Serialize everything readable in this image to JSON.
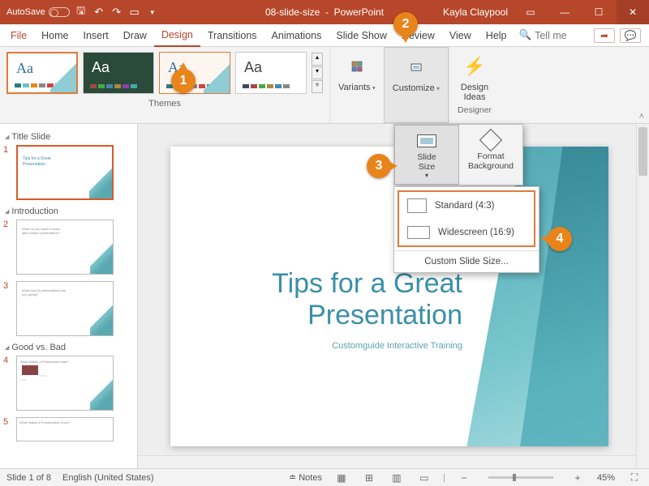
{
  "titlebar": {
    "autosave_label": "AutoSave",
    "doc_name": "08-slide-size",
    "app_name": "PowerPoint",
    "user": "Kayla Claypool"
  },
  "tabs": {
    "file": "File",
    "home": "Home",
    "insert": "Insert",
    "draw": "Draw",
    "design": "Design",
    "transitions": "Transitions",
    "animations": "Animations",
    "slideshow": "Slide Show",
    "review": "Review",
    "view": "View",
    "help": "Help",
    "tellme": "Tell me"
  },
  "ribbon": {
    "themes_label": "Themes",
    "variants_label": "Variants",
    "customize_label": "Customize",
    "designideas_label": "Design\nIdeas",
    "designer_label": "Designer"
  },
  "customize_panel": {
    "slide_size": "Slide\nSize",
    "format_bg": "Format\nBackground"
  },
  "slidesize_menu": {
    "standard": "Standard (4:3)",
    "widescreen": "Widescreen (16:9)",
    "custom": "Custom Slide Size..."
  },
  "sections": {
    "s1": "Title Slide",
    "s2": "Introduction",
    "s3": "Good vs. Bad"
  },
  "slide_nums": {
    "n1": "1",
    "n2": "2",
    "n3": "3",
    "n4": "4",
    "n5": "5"
  },
  "slide": {
    "title": "Tips for a Great Presentation",
    "subtitle": "Customguide Interactive Training"
  },
  "statusbar": {
    "slide_count": "Slide 1 of 8",
    "language": "English (United States)",
    "notes": "Notes",
    "zoom": "45%"
  },
  "badges": {
    "b1": "1",
    "b2": "2",
    "b3": "3",
    "b4": "4"
  },
  "chart_data": null
}
